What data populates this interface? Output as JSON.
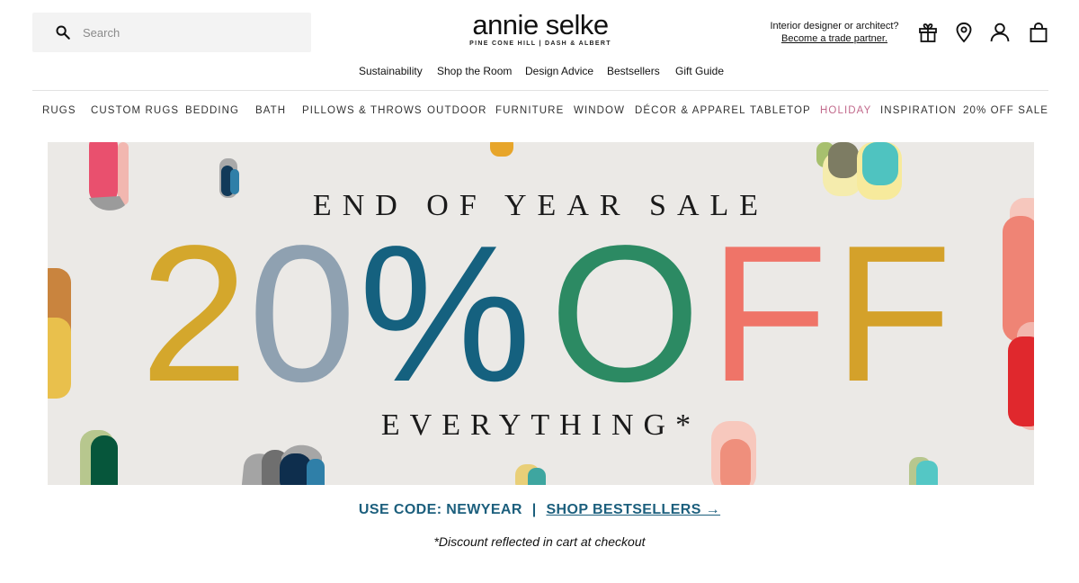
{
  "search": {
    "placeholder": "Search"
  },
  "logo": {
    "name": "annie selke",
    "tagline": "PINE CONE HILL  |  DASH & ALBERT"
  },
  "trade": {
    "question": "Interior designer or architect?",
    "link": "Become a trade partner."
  },
  "header_icons": [
    "gift-icon",
    "location-pin-icon",
    "account-icon",
    "shopping-bag-icon"
  ],
  "subnav": [
    "Sustainability",
    "Shop the Room",
    "Design Advice",
    "Bestsellers",
    "Gift Guide"
  ],
  "mainnav": [
    "RUGS",
    "CUSTOM RUGS",
    "BEDDING",
    "BATH",
    "PILLOWS & THROWS",
    "OUTDOOR",
    "FURNITURE",
    "WINDOW",
    "DÉCOR & APPAREL",
    "TABLETOP",
    "HOLIDAY",
    "INSPIRATION",
    "20% OFF SALE"
  ],
  "hero": {
    "eyebrow": "END OF YEAR SALE",
    "big": [
      "2",
      "0",
      "%",
      "O",
      "F",
      "F"
    ],
    "big_colors": [
      "#d4a72c",
      "#8fa1b1",
      "#15617f",
      "#2c8a63",
      "#ef7468",
      "#d4a12a"
    ],
    "sub": "EVERYTHING*"
  },
  "promo": {
    "code_text": "USE CODE: NEWYEAR",
    "separator": "|",
    "link": "SHOP BESTSELLERS →"
  },
  "disclaimer": "*Discount reflected in cart at checkout",
  "colors": {
    "accent": "#1c5f7d",
    "holiday": "#c26a8c",
    "hero_bg": "#ebe9e6"
  }
}
